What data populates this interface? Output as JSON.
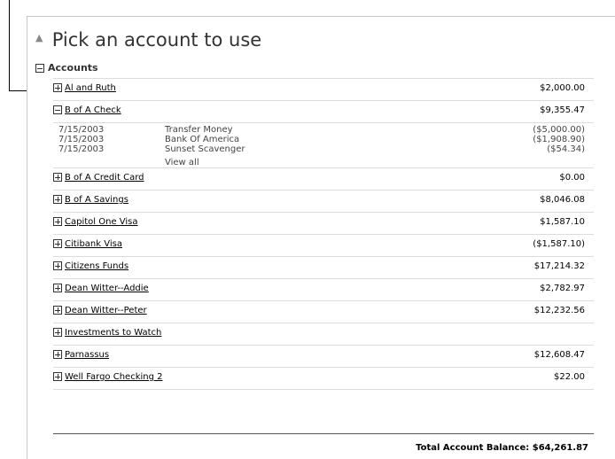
{
  "title": "Pick an account to use",
  "section_label": "Accounts",
  "accounts": [
    {
      "name": "Al and Ruth",
      "amount": "$2,000.00"
    },
    {
      "name": "B of A Check",
      "amount": "$9,355.47"
    },
    {
      "name": "B of A Credit Card",
      "amount": "$0.00"
    },
    {
      "name": "B of A Savings",
      "amount": "$8,046.08"
    },
    {
      "name": "Capitol One Visa",
      "amount": "$1,587.10"
    },
    {
      "name": "Citibank Visa",
      "amount": "($1,587.10)"
    },
    {
      "name": "Citizens Funds",
      "amount": "$17,214.32"
    },
    {
      "name": "Dean Witter--Addie",
      "amount": "$2,782.97"
    },
    {
      "name": "Dean Witter--Peter",
      "amount": "$12,232.56"
    },
    {
      "name": "Investments to Watch",
      "amount": ""
    },
    {
      "name": "Parnassus",
      "amount": "$12,608.47"
    },
    {
      "name": "Well Fargo Checking 2",
      "amount": "$22.00"
    }
  ],
  "transactions": [
    {
      "date": "7/15/2003",
      "description": "Transfer Money",
      "amount": "($5,000.00)"
    },
    {
      "date": "7/15/2003",
      "description": "Bank Of America",
      "amount": "($1,908.90)"
    },
    {
      "date": "7/15/2003",
      "description": "Sunset Scavenger",
      "amount": "($54.34)"
    }
  ],
  "view_all_label": "View all",
  "total": "Total Account Balance: $64,261.87"
}
